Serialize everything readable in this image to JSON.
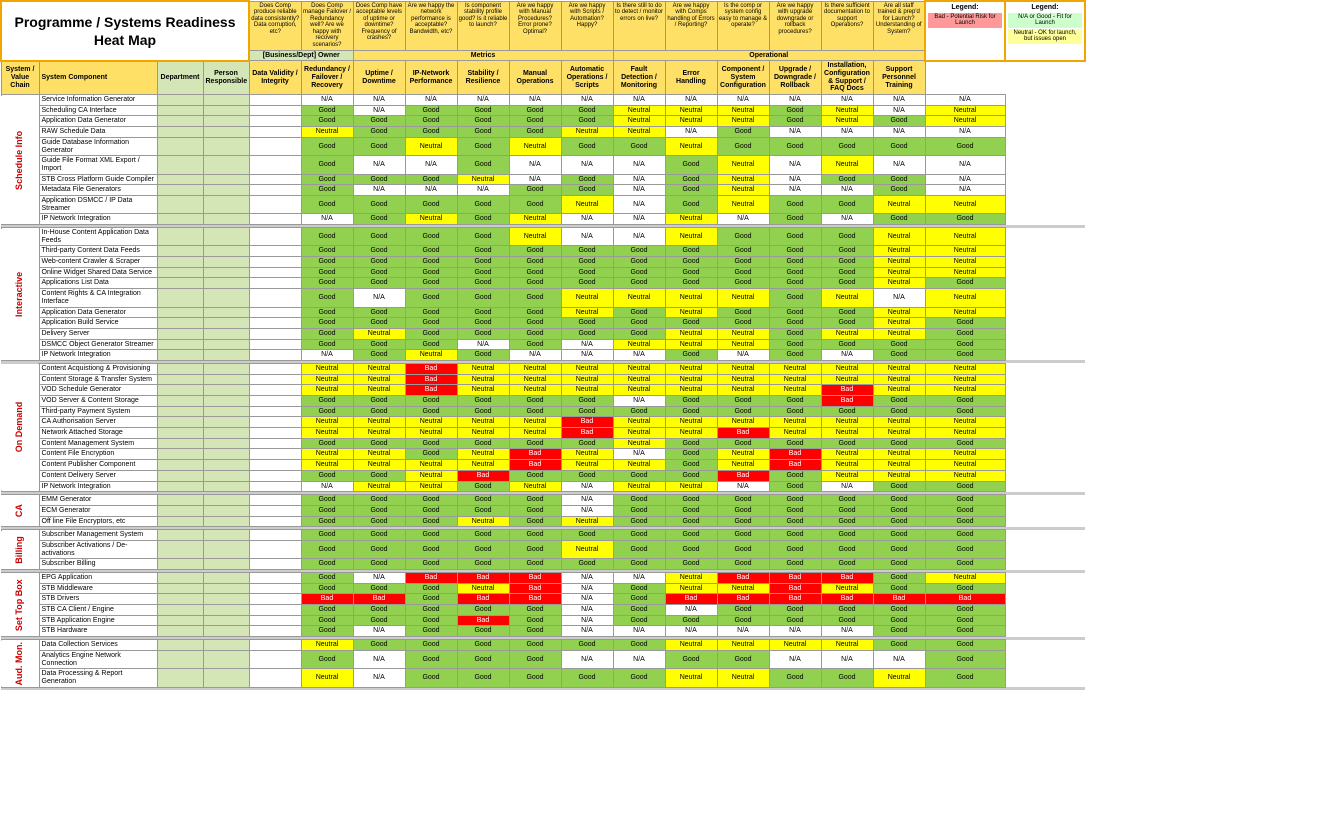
{
  "title": "Programme / Systems Readiness Heat Map",
  "legend1": {
    "title": "Legend:",
    "red": "Bad - Potential Risk for Launch",
    "color": "#ff9999"
  },
  "legend2": {
    "title": "Legend:",
    "green": "N/A or Good - Fit for Launch",
    "yellow": "Neutral - OK for launch, but issues open"
  },
  "column_questions": [
    "Does Comp produce reliable data consistently? Data corruption, etc?",
    "Does Comp manage Failover / Redundancy well? Are we happy with recovery scenarios?",
    "Does Comp have acceptable levels of uptime or downtime? Frequency of crashes?",
    "Are we happy the network performance is acceptable? Bandwidth, etc?",
    "Is component stability profile good? Is it reliable to launch?",
    "Are we happy with Manual Procedures? Error prone? Optimal?",
    "Are we happy with Scripts / Automation? Happy?",
    "Is there still to do to detect / monitor errors on live?",
    "Are we happy with Comps handling of Errors / Reporting?",
    "Is the comp or system config easy to manage & operate?",
    "Are we happy with upgrade downgrade or rollback procedures?",
    "Is there sufficient documentation to support Operations?",
    "Are all staff trained & prep'd for Launch? Understanding of System?"
  ],
  "section_headers": {
    "business": "[Business/Dept] Owner",
    "metrics": "Metrics",
    "operational": "Operational"
  },
  "column_headers": [
    "System / Value Chain",
    "System Component",
    "Department",
    "Person Responsible",
    "Data Validity / Integrity",
    "Redundancy / Failover / Recovery",
    "Uptime / Downtime",
    "IP-Network Performance",
    "Stability / Resilience",
    "Manual Operations",
    "Automatic Operations / Scripts",
    "Fault Detection / Monitoring",
    "Error Handling",
    "Component / System Configuration",
    "Upgrade / Downgrade / Rollback",
    "Installation, Configuration & Support / FAQ Docs",
    "Support Personnel Training"
  ],
  "rows": {
    "schedule_info": {
      "label": "Schedule Info",
      "items": [
        [
          "Service Information Generator",
          "",
          "",
          "N/A",
          "N/A",
          "N/A",
          "N/A",
          "N/A",
          "N/A",
          "N/A",
          "N/A",
          "N/A",
          "N/A",
          "N/A",
          "N/A",
          "N/A"
        ],
        [
          "Scheduling CA Interface",
          "",
          "",
          "Good",
          "N/A",
          "Good",
          "Good",
          "Good",
          "Good",
          "Neutral",
          "Neutral",
          "Neutral",
          "Good",
          "Neutral",
          "N/A",
          "Neutral"
        ],
        [
          "Application Data Generator",
          "",
          "",
          "Good",
          "Good",
          "Good",
          "Good",
          "Good",
          "Good",
          "Neutral",
          "Neutral",
          "Neutral",
          "Good",
          "Neutral",
          "Good",
          "Neutral"
        ],
        [
          "RAW Schedule Data",
          "",
          "",
          "Neutral",
          "Good",
          "Good",
          "Good",
          "Good",
          "Neutral",
          "Neutral",
          "N/A",
          "Good",
          "N/A",
          "N/A",
          "N/A",
          "N/A"
        ],
        [
          "Guide Database Information Generator",
          "",
          "",
          "Good",
          "Good",
          "Neutral",
          "Good",
          "Neutral",
          "Good",
          "Good",
          "Neutral",
          "Good",
          "Good",
          "Good",
          "Good",
          "Good"
        ],
        [
          "Guide File Format XML Export / Import",
          "",
          "",
          "Good",
          "N/A",
          "N/A",
          "Good",
          "N/A",
          "N/A",
          "N/A",
          "Good",
          "Neutral",
          "N/A",
          "Neutral",
          "N/A",
          "N/A"
        ],
        [
          "STB Cross Platform Guide Compiler",
          "",
          "",
          "Good",
          "Good",
          "Good",
          "Neutral",
          "N/A",
          "Good",
          "N/A",
          "Good",
          "Neutral",
          "N/A",
          "Good",
          "Good",
          "N/A"
        ],
        [
          "Metadata File Generators",
          "",
          "",
          "Good",
          "N/A",
          "N/A",
          "N/A",
          "Good",
          "Good",
          "N/A",
          "Good",
          "Neutral",
          "N/A",
          "N/A",
          "Good",
          "N/A"
        ],
        [
          "Application DSMCC / IP Data Streamer",
          "",
          "",
          "Good",
          "Good",
          "Good",
          "Good",
          "Good",
          "Neutral",
          "N/A",
          "Good",
          "Neutral",
          "Good",
          "Good",
          "Neutral",
          "Neutral"
        ],
        [
          "IP Network Integration",
          "",
          "",
          "N/A",
          "Good",
          "Neutral",
          "Good",
          "Neutral",
          "N/A",
          "N/A",
          "Neutral",
          "N/A",
          "Good",
          "N/A",
          "Good",
          "Good"
        ]
      ]
    },
    "interactive": {
      "label": "Interactive",
      "items": [
        [
          "In-House Content Application Data Feeds",
          "",
          "",
          "Good",
          "Good",
          "Good",
          "Good",
          "Neutral",
          "N/A",
          "N/A",
          "Neutral",
          "Good",
          "Good",
          "Good",
          "Neutral",
          "Neutral"
        ],
        [
          "Third-party Content Data Feeds",
          "",
          "",
          "Good",
          "Good",
          "Good",
          "Good",
          "Good",
          "Good",
          "Good",
          "Good",
          "Good",
          "Good",
          "Good",
          "Neutral",
          "Neutral"
        ],
        [
          "Web-content Crawler & Scraper",
          "",
          "",
          "Good",
          "Good",
          "Good",
          "Good",
          "Good",
          "Good",
          "Good",
          "Good",
          "Good",
          "Good",
          "Good",
          "Neutral",
          "Neutral"
        ],
        [
          "Online Widget Shared Data Service",
          "",
          "",
          "Good",
          "Good",
          "Good",
          "Good",
          "Good",
          "Good",
          "Good",
          "Good",
          "Good",
          "Good",
          "Good",
          "Neutral",
          "Neutral"
        ],
        [
          "Applications List Data",
          "",
          "",
          "Good",
          "Good",
          "Good",
          "Good",
          "Good",
          "Good",
          "Good",
          "Good",
          "Good",
          "Good",
          "Good",
          "Neutral",
          "Good"
        ],
        [
          "Content Rights & CA Integration Interface",
          "",
          "",
          "Good",
          "N/A",
          "Good",
          "Good",
          "Good",
          "Neutral",
          "Neutral",
          "Neutral",
          "Neutral",
          "Good",
          "Neutral",
          "N/A",
          "Neutral"
        ],
        [
          "Application Data Generator",
          "",
          "",
          "Good",
          "Good",
          "Good",
          "Good",
          "Good",
          "Neutral",
          "Good",
          "Neutral",
          "Good",
          "Good",
          "Good",
          "Neutral",
          "Neutral"
        ],
        [
          "Application Build Service",
          "",
          "",
          "Good",
          "Good",
          "Good",
          "Good",
          "Good",
          "Good",
          "Good",
          "Good",
          "Good",
          "Good",
          "Good",
          "Neutral",
          "Good"
        ],
        [
          "Delivery Server",
          "",
          "",
          "Good",
          "Neutral",
          "Good",
          "Good",
          "Good",
          "Good",
          "Good",
          "Neutral",
          "Neutral",
          "Good",
          "Neutral",
          "Neutral",
          "Good"
        ],
        [
          "DSMCC Object Generator Streamer",
          "",
          "",
          "Good",
          "Good",
          "Good",
          "N/A",
          "Good",
          "N/A",
          "Neutral",
          "Neutral",
          "Neutral",
          "Good",
          "Good",
          "Good",
          "Good"
        ],
        [
          "IP Network Integration",
          "",
          "",
          "N/A",
          "Good",
          "Neutral",
          "Good",
          "N/A",
          "N/A",
          "N/A",
          "Good",
          "N/A",
          "Good",
          "N/A",
          "Good",
          "Good"
        ]
      ]
    },
    "on_demand": {
      "label": "On Demand",
      "items": [
        [
          "Content Acquistiong & Provisioning",
          "",
          "",
          "Neutral",
          "Neutral",
          "Bad",
          "Neutral",
          "Neutral",
          "Neutral",
          "Neutral",
          "Neutral",
          "Neutral",
          "Neutral",
          "Neutral",
          "Neutral",
          "Neutral"
        ],
        [
          "Content Storage & Transfer System",
          "",
          "",
          "Neutral",
          "Neutral",
          "Bad",
          "Neutral",
          "Neutral",
          "Neutral",
          "Neutral",
          "Neutral",
          "Neutral",
          "Neutral",
          "Neutral",
          "Neutral",
          "Neutral"
        ],
        [
          "VOD Schedule Generator",
          "",
          "",
          "Neutral",
          "Neutral",
          "Bad",
          "Neutral",
          "Neutral",
          "Neutral",
          "Neutral",
          "Neutral",
          "Neutral",
          "Neutral",
          "Bad",
          "Neutral",
          "Neutral"
        ],
        [
          "VOD Server & Content Storage",
          "",
          "",
          "Good",
          "Good",
          "Good",
          "Good",
          "Good",
          "Good",
          "N/A",
          "Good",
          "Good",
          "Good",
          "Bad",
          "Good",
          "Good"
        ],
        [
          "Third-party Payment System",
          "",
          "",
          "Good",
          "Good",
          "Good",
          "Good",
          "Good",
          "Good",
          "Good",
          "Good",
          "Good",
          "Good",
          "Good",
          "Good",
          "Good"
        ],
        [
          "CA Authorisation Server",
          "",
          "",
          "Neutral",
          "Neutral",
          "Neutral",
          "Neutral",
          "Neutral",
          "Bad",
          "Neutral",
          "Neutral",
          "Neutral",
          "Neutral",
          "Neutral",
          "Neutral",
          "Neutral"
        ],
        [
          "Network Attached Storage",
          "",
          "",
          "Neutral",
          "Neutral",
          "Neutral",
          "Neutral",
          "Neutral",
          "Bad",
          "Neutral",
          "Neutral",
          "Bad",
          "Neutral",
          "Neutral",
          "Neutral",
          "Neutral"
        ],
        [
          "Content Management System",
          "",
          "",
          "Good",
          "Good",
          "Good",
          "Good",
          "Good",
          "Good",
          "Neutral",
          "Good",
          "Good",
          "Good",
          "Good",
          "Good",
          "Good"
        ],
        [
          "Content File Encryption",
          "",
          "",
          "Neutral",
          "Neutral",
          "Good",
          "Neutral",
          "Bad",
          "Neutral",
          "N/A",
          "Good",
          "Neutral",
          "Bad",
          "Neutral",
          "Neutral",
          "Neutral"
        ],
        [
          "Content Publisher Component",
          "",
          "",
          "Neutral",
          "Neutral",
          "Neutral",
          "Neutral",
          "Bad",
          "Neutral",
          "Neutral",
          "Good",
          "Neutral",
          "Bad",
          "Neutral",
          "Neutral",
          "Neutral"
        ],
        [
          "Content Delivery Server",
          "",
          "",
          "Good",
          "Good",
          "Neutral",
          "Bad",
          "Good",
          "Good",
          "Good",
          "Good",
          "Bad",
          "Good",
          "Neutral",
          "Neutral",
          "Neutral"
        ],
        [
          "IP Network Integration",
          "",
          "",
          "N/A",
          "Neutral",
          "Neutral",
          "Good",
          "Neutral",
          "N/A",
          "Neutral",
          "Neutral",
          "N/A",
          "Good",
          "N/A",
          "Good",
          "Good"
        ]
      ]
    },
    "ca": {
      "label": "CA",
      "items": [
        [
          "EMM Generator",
          "",
          "",
          "Good",
          "Good",
          "Good",
          "Good",
          "Good",
          "N/A",
          "Good",
          "Good",
          "Good",
          "Good",
          "Good",
          "Good",
          "Good"
        ],
        [
          "ECM Generator",
          "",
          "",
          "Good",
          "Good",
          "Good",
          "Good",
          "Good",
          "N/A",
          "Good",
          "Good",
          "Good",
          "Good",
          "Good",
          "Good",
          "Good"
        ],
        [
          "Off line File Encryptors, etc",
          "",
          "",
          "Good",
          "Good",
          "Good",
          "Neutral",
          "Good",
          "Neutral",
          "Good",
          "Good",
          "Good",
          "Good",
          "Good",
          "Good",
          "Good"
        ]
      ]
    },
    "billing": {
      "label": "Billing",
      "items": [
        [
          "Subscriber Management System",
          "",
          "",
          "Good",
          "Good",
          "Good",
          "Good",
          "Good",
          "Good",
          "Good",
          "Good",
          "Good",
          "Good",
          "Good",
          "Good",
          "Good"
        ],
        [
          "Subscriber Activations / De-activations",
          "",
          "",
          "Good",
          "Good",
          "Good",
          "Good",
          "Good",
          "Neutral",
          "Good",
          "Good",
          "Good",
          "Good",
          "Good",
          "Good",
          "Good"
        ],
        [
          "Subscriber Billing",
          "",
          "",
          "Good",
          "Good",
          "Good",
          "Good",
          "Good",
          "Good",
          "Good",
          "Good",
          "Good",
          "Good",
          "Good",
          "Good",
          "Good"
        ]
      ]
    },
    "set_top_box": {
      "label": "Set Top Box",
      "items": [
        [
          "EPG Application",
          "",
          "",
          "Good",
          "N/A",
          "Bad",
          "Bad",
          "Bad",
          "N/A",
          "N/A",
          "Neutral",
          "Bad",
          "Bad",
          "Bad",
          "Good",
          "Neutral"
        ],
        [
          "STB Middleware",
          "",
          "",
          "Good",
          "Good",
          "Good",
          "Neutral",
          "Bad",
          "N/A",
          "Good",
          "Neutral",
          "Neutral",
          "Bad",
          "Neutral",
          "Good",
          "Good"
        ],
        [
          "STB Drivers",
          "",
          "",
          "Bad",
          "Bad",
          "Good",
          "Bad",
          "Bad",
          "N/A",
          "Good",
          "Bad",
          "Bad",
          "Bad",
          "Bad",
          "Bad",
          "Bad"
        ],
        [
          "STB CA Client / Engine",
          "",
          "",
          "Good",
          "Good",
          "Good",
          "Good",
          "Good",
          "N/A",
          "Good",
          "N/A",
          "Good",
          "Good",
          "Good",
          "Good",
          "Good"
        ],
        [
          "STB Application Engine",
          "",
          "",
          "Good",
          "Good",
          "Good",
          "Bad",
          "Good",
          "N/A",
          "Good",
          "Good",
          "Good",
          "Good",
          "Good",
          "Good",
          "Good"
        ],
        [
          "STB Hardware",
          "",
          "",
          "Good",
          "N/A",
          "Good",
          "Good",
          "Good",
          "N/A",
          "N/A",
          "N/A",
          "N/A",
          "N/A",
          "N/A",
          "Good",
          "Good"
        ]
      ]
    },
    "aud_mon": {
      "label": "Aud. Mon.",
      "items": [
        [
          "Data Collection Services",
          "",
          "",
          "Neutral",
          "Good",
          "Good",
          "Good",
          "Good",
          "Good",
          "Good",
          "Neutral",
          "Neutral",
          "Neutral",
          "Neutral",
          "Good",
          "Good"
        ],
        [
          "Analytics Engine Network Connection",
          "",
          "",
          "Good",
          "N/A",
          "Good",
          "Good",
          "Good",
          "N/A",
          "N/A",
          "Good",
          "Good",
          "N/A",
          "N/A",
          "N/A",
          "Good"
        ],
        [
          "Data Processing & Report Generation",
          "",
          "",
          "Neutral",
          "N/A",
          "Good",
          "Good",
          "Good",
          "Good",
          "Good",
          "Neutral",
          "Neutral",
          "Good",
          "Good",
          "Neutral",
          "Good"
        ]
      ]
    }
  }
}
